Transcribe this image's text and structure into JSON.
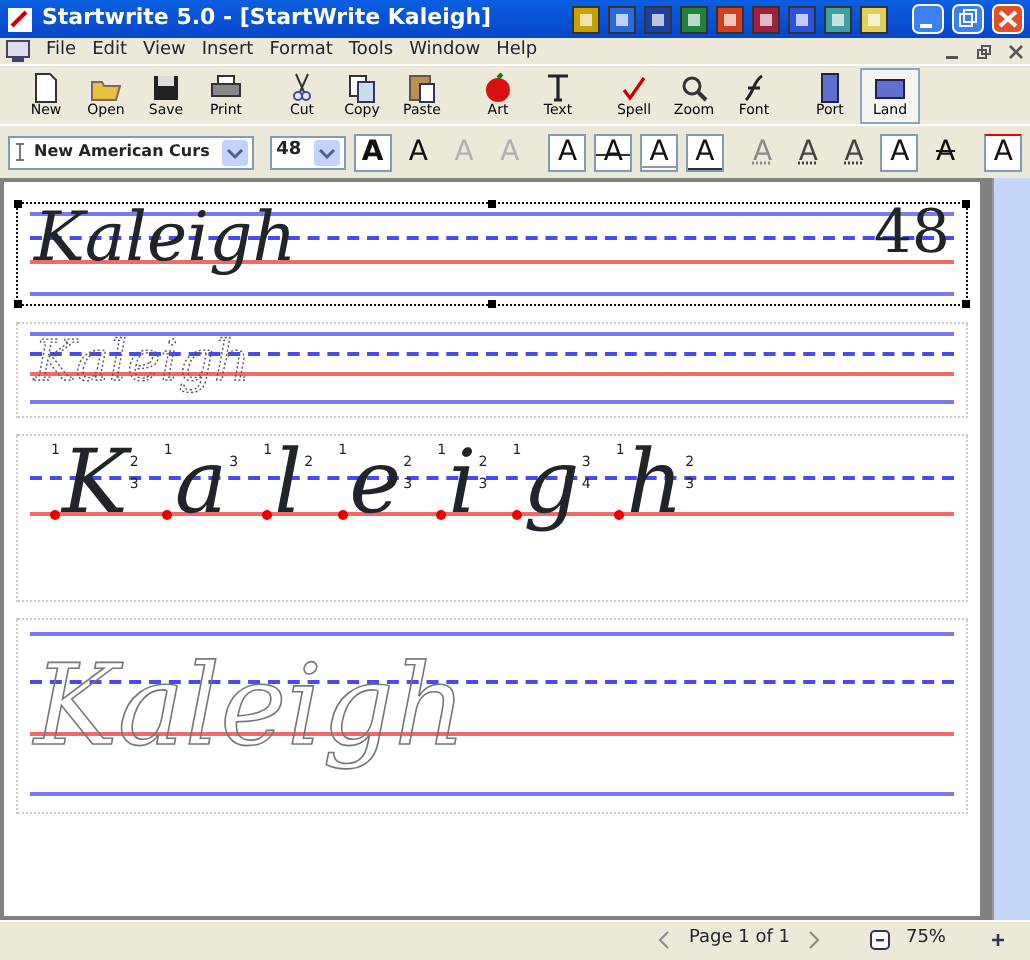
{
  "window": {
    "title": "Startwrite 5.0 - [StartWrite Kaleigh]"
  },
  "menu": [
    "File",
    "Edit",
    "View",
    "Insert",
    "Format",
    "Tools",
    "Window",
    "Help"
  ],
  "toolbar": [
    {
      "label": "New",
      "selected": false
    },
    {
      "label": "Open",
      "selected": false
    },
    {
      "label": "Save",
      "selected": false
    },
    {
      "label": "Print",
      "selected": false
    },
    {
      "label": "Cut",
      "selected": false
    },
    {
      "label": "Copy",
      "selected": false
    },
    {
      "label": "Paste",
      "selected": false
    },
    {
      "label": "Art",
      "selected": false
    },
    {
      "label": "Text",
      "selected": false
    },
    {
      "label": "Spell",
      "selected": false
    },
    {
      "label": "Zoom",
      "selected": false
    },
    {
      "label": "Font",
      "selected": false
    },
    {
      "label": "Port",
      "selected": false
    },
    {
      "label": "Land",
      "selected": true
    }
  ],
  "font_select": {
    "value": "New American Curs"
  },
  "size_select": {
    "value": "48"
  },
  "format_buttons": [
    {
      "label": "A",
      "kind": "bold",
      "selected": true,
      "disabled": false
    },
    {
      "label": "A",
      "kind": "plain",
      "selected": false,
      "disabled": false
    },
    {
      "label": "A",
      "kind": "plain",
      "selected": false,
      "disabled": true
    },
    {
      "label": "A",
      "kind": "plain",
      "selected": false,
      "disabled": true
    },
    {
      "label": "A",
      "kind": "top-line",
      "selected": true,
      "disabled": false
    },
    {
      "label": "A",
      "kind": "mid-line",
      "selected": true,
      "disabled": false
    },
    {
      "label": "A",
      "kind": "base-line",
      "selected": true,
      "disabled": false
    },
    {
      "label": "A",
      "kind": "bottom-line",
      "selected": true,
      "disabled": false
    },
    {
      "label": "A",
      "kind": "dotted",
      "selected": false,
      "disabled": true
    },
    {
      "label": "A",
      "kind": "dotted",
      "selected": false,
      "disabled": false
    },
    {
      "label": "A",
      "kind": "dotted",
      "selected": false,
      "disabled": false
    },
    {
      "label": "A",
      "kind": "plain",
      "selected": true,
      "disabled": false
    },
    {
      "label": "A",
      "kind": "arrows",
      "selected": false,
      "disabled": false
    },
    {
      "label": "A",
      "kind": "start-dot",
      "selected": true,
      "disabled": false
    }
  ],
  "lines": [
    {
      "kind": "solid",
      "text": "Kaleigh",
      "number": "48",
      "selected": true
    },
    {
      "kind": "dotted",
      "text": "Kaleigh",
      "selected": false
    },
    {
      "kind": "numbered",
      "selected": false,
      "letters": [
        {
          "char": "K",
          "strokes": [
            "1",
            "2",
            "3"
          ]
        },
        {
          "char": "a",
          "strokes": [
            "1",
            "3"
          ]
        },
        {
          "char": "l",
          "strokes": [
            "1",
            "2"
          ]
        },
        {
          "char": "e",
          "strokes": [
            "1",
            "2",
            "3"
          ]
        },
        {
          "char": "i",
          "strokes": [
            "1",
            "2",
            "3"
          ]
        },
        {
          "char": "g",
          "strokes": [
            "1",
            "3",
            "4"
          ]
        },
        {
          "char": "h",
          "strokes": [
            "1",
            "2",
            "3"
          ]
        }
      ]
    },
    {
      "kind": "outline",
      "text": "Kaleigh",
      "selected": false
    }
  ],
  "status_bar": {
    "page": "Page 1 of 1",
    "zoom": "75%"
  }
}
